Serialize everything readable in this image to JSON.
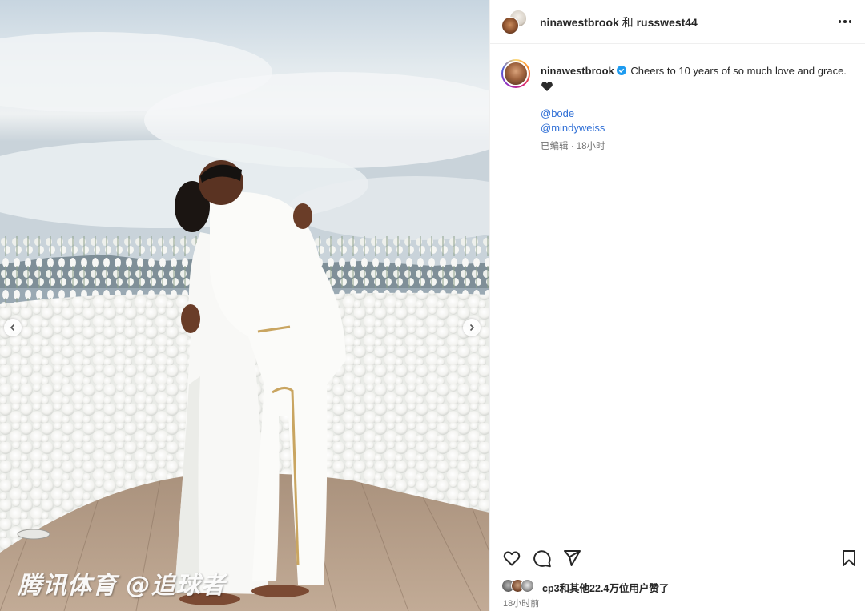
{
  "post": {
    "watermark": "腾讯体育 @追球者"
  },
  "header": {
    "user1": "ninawestbrook",
    "joiner": " 和 ",
    "user2": "russwest44"
  },
  "caption": {
    "username": "ninawestbrook",
    "text": "Cheers to 10 years of so much love and grace.",
    "emoji": "black-heart",
    "mentions": [
      "@bode",
      "@mindyweiss"
    ],
    "meta": "已编辑 · 18小时"
  },
  "footer": {
    "likes_text": "cp3和其他22.4万位用户赞了",
    "timestamp": "18小时前"
  },
  "colors": {
    "link": "#2f6fd6",
    "verified": "#1d9bf0",
    "secondary_text": "#737373"
  },
  "icons": [
    "more-options-icon",
    "verified-badge-icon",
    "like-heart-icon",
    "comment-icon",
    "share-icon",
    "save-bookmark-icon",
    "chevron-left-icon",
    "chevron-right-icon"
  ]
}
